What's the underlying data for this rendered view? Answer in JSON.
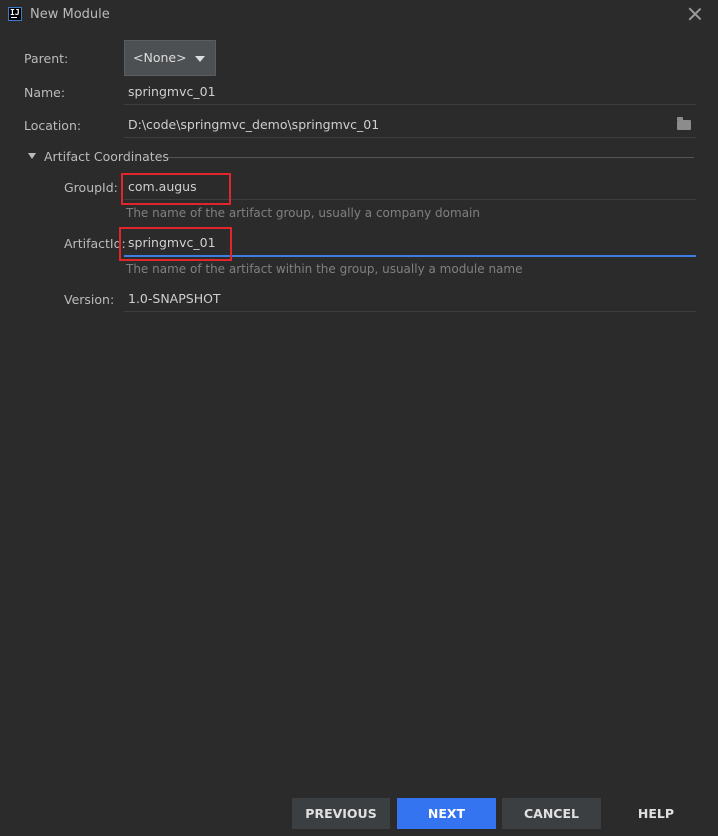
{
  "window": {
    "title": "New Module",
    "app_icon_text": "IJ"
  },
  "form": {
    "parent": {
      "label": "Parent:",
      "value": "<None>"
    },
    "name": {
      "label": "Name:",
      "value": "springmvc_01"
    },
    "location": {
      "label": "Location:",
      "value": "D:\\code\\springmvc_demo\\springmvc_01"
    }
  },
  "artifact": {
    "section_title": "Artifact Coordinates",
    "group_id": {
      "label": "GroupId:",
      "value": "com.augus",
      "hint": "The name of the artifact group, usually a company domain"
    },
    "artifact_id": {
      "label": "ArtifactId:",
      "value": "springmvc_01",
      "hint": "The name of the artifact within the group, usually a module name"
    },
    "version": {
      "label": "Version:",
      "value": "1.0-SNAPSHOT"
    }
  },
  "footer": {
    "previous": "PREVIOUS",
    "next": "NEXT",
    "cancel": "CANCEL",
    "help": "HELP"
  },
  "colors": {
    "background": "#2b2b2b",
    "accent": "#3574f0",
    "highlight": "#e0252b"
  }
}
